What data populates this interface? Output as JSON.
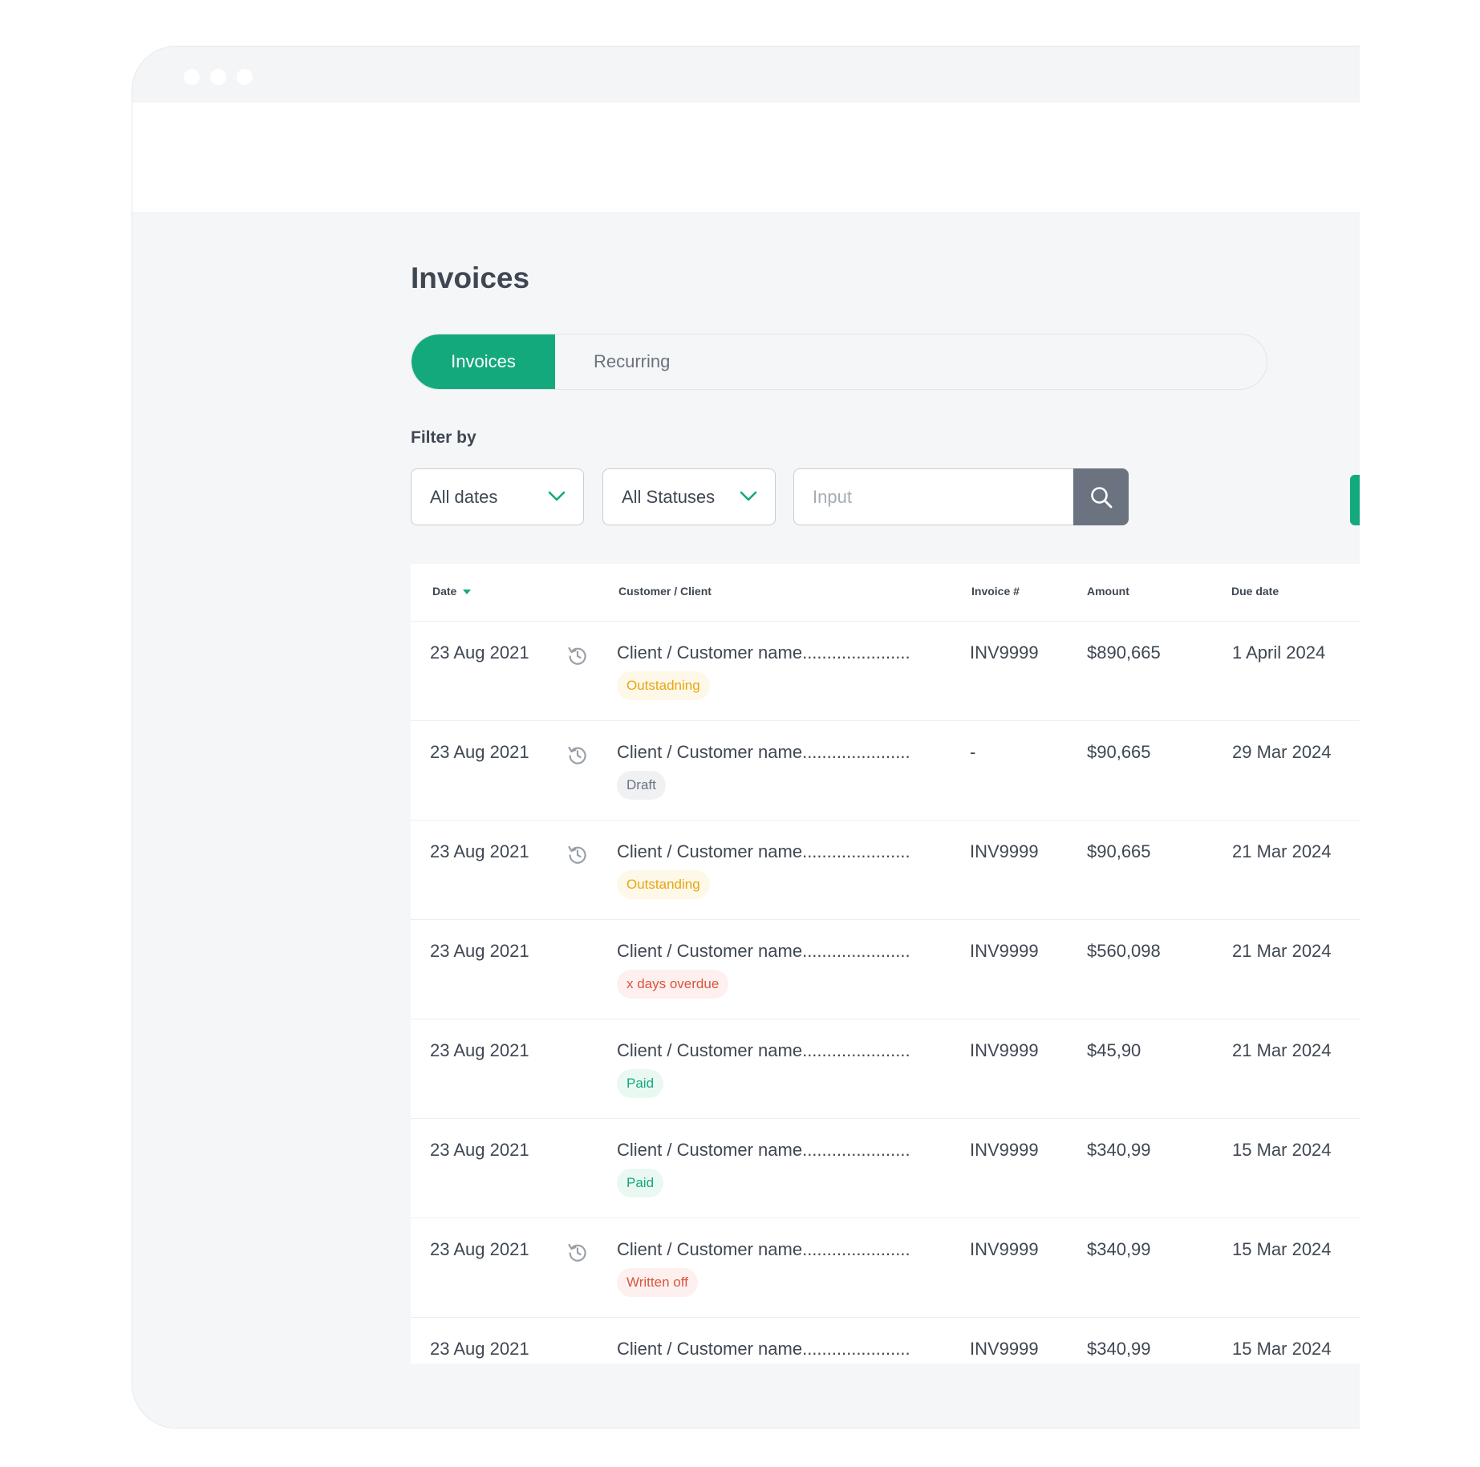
{
  "page": {
    "title": "Invoices",
    "tabs": [
      {
        "label": "Invoices",
        "active": true
      },
      {
        "label": "Recurring",
        "active": false
      }
    ],
    "filter_label": "Filter by",
    "filters": {
      "dates": "All dates",
      "statuses": "All Statuses",
      "search_placeholder": "Input"
    }
  },
  "table": {
    "columns": [
      "Date",
      "Customer / Client",
      "Invoice #",
      "Amount",
      "Due date"
    ],
    "rows": [
      {
        "date": "23 Aug 2021",
        "history": true,
        "client": "Client / Customer name......................",
        "status": "Outstadning",
        "status_type": "outstanding",
        "invoice": "INV9999",
        "amount": "$890,665",
        "due": "1 April 2024"
      },
      {
        "date": "23 Aug 2021",
        "history": true,
        "client": "Client / Customer name......................",
        "status": "Draft",
        "status_type": "draft",
        "invoice": "-",
        "amount": "$90,665",
        "due": "29 Mar 2024"
      },
      {
        "date": "23 Aug 2021",
        "history": true,
        "client": "Client / Customer name......................",
        "status": "Outstanding",
        "status_type": "outstanding",
        "invoice": "INV9999",
        "amount": "$90,665",
        "due": "21 Mar 2024"
      },
      {
        "date": "23 Aug 2021",
        "history": false,
        "client": "Client / Customer name......................",
        "status": "x days overdue",
        "status_type": "overdue",
        "invoice": "INV9999",
        "amount": "$560,098",
        "due": "21 Mar 2024"
      },
      {
        "date": "23 Aug 2021",
        "history": false,
        "client": "Client / Customer name......................",
        "status": "Paid",
        "status_type": "paid",
        "invoice": "INV9999",
        "amount": "$45,90",
        "due": "21 Mar 2024"
      },
      {
        "date": "23 Aug 2021",
        "history": false,
        "client": "Client / Customer name......................",
        "status": "Paid",
        "status_type": "paid",
        "invoice": "INV9999",
        "amount": "$340,99",
        "due": "15 Mar 2024"
      },
      {
        "date": "23 Aug 2021",
        "history": true,
        "client": "Client / Customer name......................",
        "status": "Written off",
        "status_type": "writtenoff",
        "invoice": "INV9999",
        "amount": "$340,99",
        "due": "15 Mar 2024"
      },
      {
        "date": "23 Aug 2021",
        "history": false,
        "client": "Client / Customer name......................",
        "status": "",
        "status_type": "",
        "invoice": "INV9999",
        "amount": "$340,99",
        "due": "15 Mar 2024"
      }
    ]
  },
  "colors": {
    "accent": "#14a97c",
    "search_button": "#6b7380",
    "outstanding": "#e8a514",
    "overdue": "#d9553f"
  },
  "icons": {
    "dropdown": "chevron-down-icon",
    "search": "search-icon",
    "history": "history-icon"
  }
}
